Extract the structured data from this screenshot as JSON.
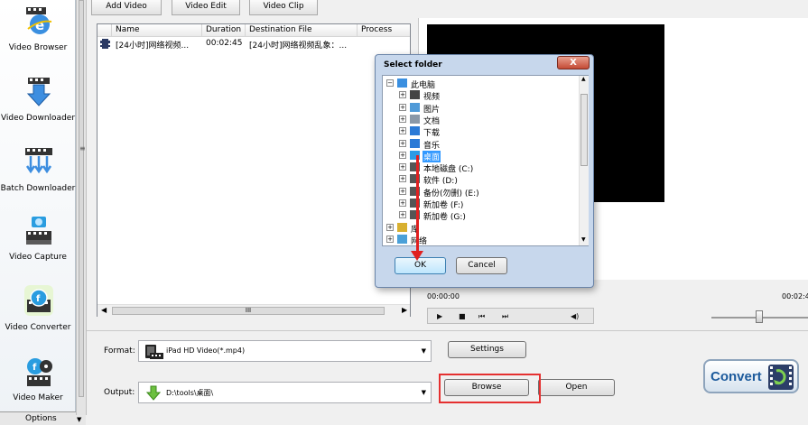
{
  "sidebar": {
    "items": [
      {
        "label": "Video Browser",
        "icon": "globe-video-icon"
      },
      {
        "label": "Video Downloader",
        "icon": "download-arrow-icon"
      },
      {
        "label": "Batch Downloader",
        "icon": "batch-download-icon"
      },
      {
        "label": "Video Capture",
        "icon": "camera-capture-icon"
      },
      {
        "label": "Video Converter",
        "icon": "converter-icon"
      },
      {
        "label": "Video Maker",
        "icon": "video-maker-icon"
      }
    ],
    "options_label": "Options"
  },
  "tabs": [
    "Add Video",
    "Video Edit",
    "Video Clip"
  ],
  "file_list": {
    "columns": [
      "Name",
      "Duration",
      "Destination File",
      "Process"
    ],
    "rows": [
      {
        "name": "[24小时]网络视频...",
        "duration": "00:02:45",
        "destination": "[24小时]网络视频乱象：...",
        "process": ""
      }
    ],
    "scroll_grip": "III"
  },
  "player": {
    "time_current": "00:00:00",
    "time_total": "00:02:4"
  },
  "format": {
    "label": "Format:",
    "value": "iPad HD Video(*.mp4)",
    "settings_label": "Settings"
  },
  "output": {
    "label": "Output:",
    "value": "D:\\tools\\桌面\\",
    "browse_label": "Browse",
    "open_label": "Open"
  },
  "convert_label": "Convert",
  "dialog": {
    "title": "Select folder",
    "close": "X",
    "ok_label": "OK",
    "cancel_label": "Cancel",
    "tree": [
      {
        "label": "此电脑",
        "level": 0,
        "sign": "−",
        "icon": "computer-icon"
      },
      {
        "label": "视频",
        "level": 1,
        "sign": "+",
        "icon": "video-folder-icon"
      },
      {
        "label": "图片",
        "level": 1,
        "sign": "+",
        "icon": "pictures-folder-icon"
      },
      {
        "label": "文档",
        "level": 1,
        "sign": "+",
        "icon": "documents-folder-icon"
      },
      {
        "label": "下载",
        "level": 1,
        "sign": "+",
        "icon": "downloads-folder-icon"
      },
      {
        "label": "音乐",
        "level": 1,
        "sign": "+",
        "icon": "music-folder-icon"
      },
      {
        "label": "桌面",
        "level": 1,
        "sign": "+",
        "icon": "desktop-folder-icon",
        "selected": true
      },
      {
        "label": "本地磁盘 (C:)",
        "level": 1,
        "sign": "+",
        "icon": "drive-icon"
      },
      {
        "label": "软件 (D:)",
        "level": 1,
        "sign": "+",
        "icon": "drive-icon"
      },
      {
        "label": "备份(勿删) (E:)",
        "level": 1,
        "sign": "+",
        "icon": "drive-icon"
      },
      {
        "label": "新加卷 (F:)",
        "level": 1,
        "sign": "+",
        "icon": "drive-icon"
      },
      {
        "label": "新加卷 (G:)",
        "level": 1,
        "sign": "+",
        "icon": "drive-icon"
      },
      {
        "label": "库",
        "level": 0,
        "sign": "+",
        "icon": "library-icon"
      },
      {
        "label": "网络",
        "level": 0,
        "sign": "+",
        "icon": "network-icon"
      }
    ]
  },
  "colors": {
    "highlight": "#e53030",
    "selection": "#3399ff",
    "accent": "#1c5a9c"
  }
}
